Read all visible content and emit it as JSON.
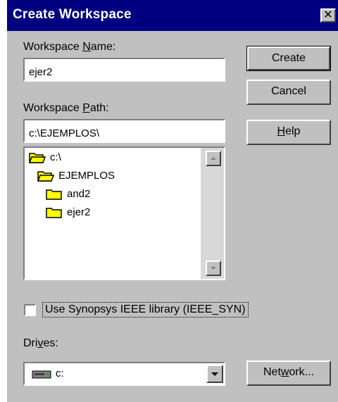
{
  "dialog": {
    "title": "Create Workspace",
    "close_glyph": "✕"
  },
  "workspace_name": {
    "label_pre": "Workspace ",
    "label_mnemonic": "N",
    "label_post": "ame:",
    "value": "ejer2"
  },
  "workspace_path": {
    "label_pre": "Workspace ",
    "label_mnemonic": "P",
    "label_post": "ath:",
    "value": "c:\\EJEMPLOS\\"
  },
  "folder_tree": {
    "items": [
      {
        "label": "c:\\",
        "icon": "open-folder-icon"
      },
      {
        "label": "EJEMPLOS",
        "icon": "open-folder-icon"
      },
      {
        "label": "and2",
        "icon": "folder-icon"
      },
      {
        "label": "ejer2",
        "icon": "folder-icon"
      }
    ]
  },
  "buttons": {
    "create": "Create",
    "cancel": "Cancel",
    "help_mnemonic": "H",
    "help_rest": "elp",
    "network_pre": "Net",
    "network_mnemonic": "w",
    "network_post": "ork..."
  },
  "synopsys": {
    "label": "Use Synopsys IEEE library (IEEE_SYN)",
    "checked": false
  },
  "drives": {
    "label_pre": "Dri",
    "label_mnemonic": "v",
    "label_post": "es:",
    "selected": "c:",
    "icon": "drive-icon"
  },
  "colors": {
    "titlebar": "#000080",
    "face": "#c0c0c0",
    "folder": "#ffff00"
  }
}
